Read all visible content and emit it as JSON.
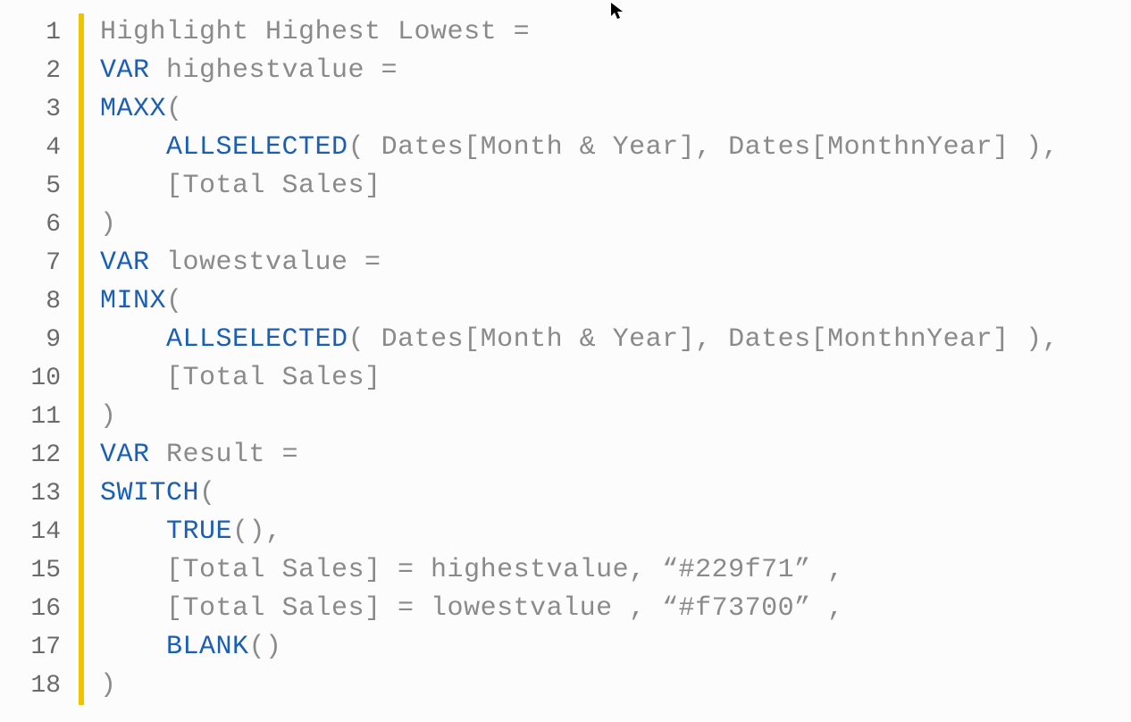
{
  "editor": {
    "cursor_name": "mouse-cursor",
    "lines": [
      {
        "num": "1",
        "tokens": [
          {
            "cls": "txt",
            "t": "Highlight Highest Lowest ="
          }
        ]
      },
      {
        "num": "2",
        "tokens": [
          {
            "cls": "kw",
            "t": "VAR"
          },
          {
            "cls": "txt",
            "t": " highestvalue ="
          }
        ]
      },
      {
        "num": "3",
        "tokens": [
          {
            "cls": "fn",
            "t": "MAXX"
          },
          {
            "cls": "txt",
            "t": "("
          }
        ]
      },
      {
        "num": "4",
        "tokens": [
          {
            "cls": "txt",
            "t": "    "
          },
          {
            "cls": "fn",
            "t": "ALLSELECTED"
          },
          {
            "cls": "txt",
            "t": "( Dates[Month & Year], Dates[MonthnYear] ),"
          }
        ]
      },
      {
        "num": "5",
        "tokens": [
          {
            "cls": "txt",
            "t": "    [Total Sales]"
          }
        ]
      },
      {
        "num": "6",
        "tokens": [
          {
            "cls": "txt",
            "t": ")"
          }
        ]
      },
      {
        "num": "7",
        "tokens": [
          {
            "cls": "kw",
            "t": "VAR"
          },
          {
            "cls": "txt",
            "t": " lowestvalue ="
          }
        ]
      },
      {
        "num": "8",
        "tokens": [
          {
            "cls": "fn",
            "t": "MINX"
          },
          {
            "cls": "txt",
            "t": "("
          }
        ]
      },
      {
        "num": "9",
        "tokens": [
          {
            "cls": "txt",
            "t": "    "
          },
          {
            "cls": "fn",
            "t": "ALLSELECTED"
          },
          {
            "cls": "txt",
            "t": "( Dates[Month & Year], Dates[MonthnYear] ),"
          }
        ]
      },
      {
        "num": "10",
        "tokens": [
          {
            "cls": "txt",
            "t": "    [Total Sales]"
          }
        ]
      },
      {
        "num": "11",
        "tokens": [
          {
            "cls": "txt",
            "t": ")"
          }
        ]
      },
      {
        "num": "12",
        "tokens": [
          {
            "cls": "kw",
            "t": "VAR"
          },
          {
            "cls": "txt",
            "t": " Result ="
          }
        ]
      },
      {
        "num": "13",
        "tokens": [
          {
            "cls": "fn",
            "t": "SWITCH"
          },
          {
            "cls": "txt",
            "t": "("
          }
        ]
      },
      {
        "num": "14",
        "tokens": [
          {
            "cls": "txt",
            "t": "    "
          },
          {
            "cls": "fn",
            "t": "TRUE"
          },
          {
            "cls": "txt",
            "t": "(),"
          }
        ]
      },
      {
        "num": "15",
        "tokens": [
          {
            "cls": "txt",
            "t": "    [Total Sales] = highestvalue, “#229f71” ,"
          }
        ]
      },
      {
        "num": "16",
        "tokens": [
          {
            "cls": "txt",
            "t": "    [Total Sales] = lowestvalue , “#f73700” ,"
          }
        ]
      },
      {
        "num": "17",
        "tokens": [
          {
            "cls": "txt",
            "t": "    "
          },
          {
            "cls": "fn",
            "t": "BLANK"
          },
          {
            "cls": "txt",
            "t": "()"
          }
        ]
      },
      {
        "num": "18",
        "tokens": [
          {
            "cls": "txt",
            "t": ")"
          }
        ]
      }
    ]
  }
}
